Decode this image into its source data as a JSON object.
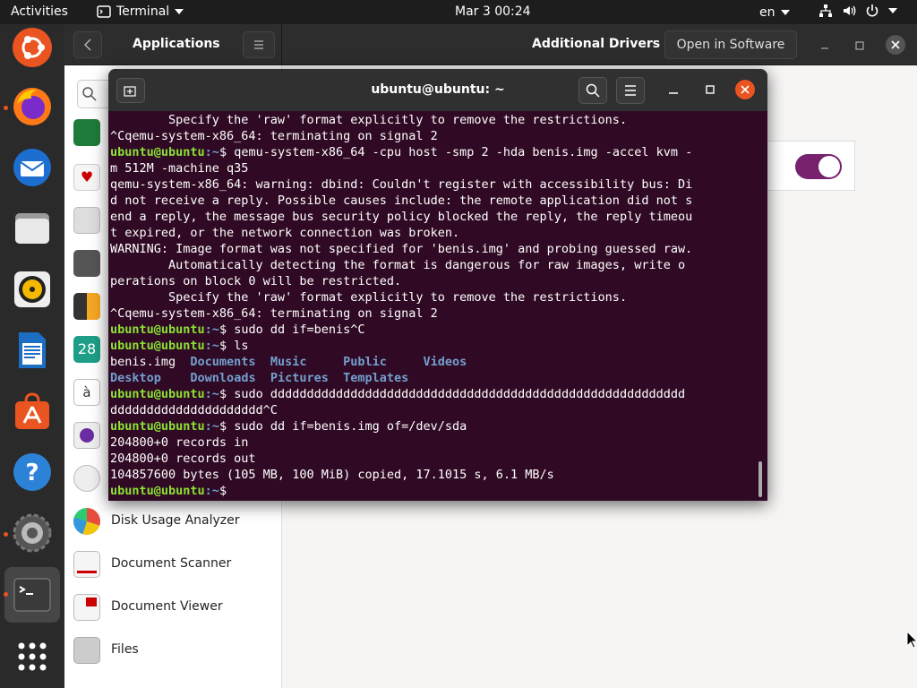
{
  "topbar": {
    "activities": "Activities",
    "app": "Terminal",
    "clock": "Mar 3  00:24",
    "lang": "en"
  },
  "dock": {
    "items": [
      "ubuntu-logo",
      "firefox",
      "thunderbird",
      "files",
      "rhythmbox",
      "libreoffice-writer",
      "ubuntu-software",
      "help",
      "settings",
      "terminal",
      "show-apps"
    ]
  },
  "software": {
    "header": {
      "section": "Applications",
      "title": "Additional Drivers",
      "open_button": "Open in Software"
    },
    "side_list": [
      "Disk Usage Analyzer",
      "Document Scanner",
      "Document Viewer",
      "Files"
    ],
    "side_icon_labels": {
      "calendar": "28",
      "charmap": "à"
    },
    "toggle_on": true
  },
  "terminal": {
    "title": "ubuntu@ubuntu: ~",
    "lines": [
      {
        "t": "        Specify the 'raw' format explicitly to remove the restrictions."
      },
      {
        "t": "^Cqemu-system-x86_64: terminating on signal 2"
      },
      {
        "user": "ubuntu@ubuntu",
        "path": ":~",
        "t": "$ qemu-system-x86_64 -cpu host -smp 2 -hda benis.img -accel kvm -"
      },
      {
        "t": "m 512M -machine q35"
      },
      {
        "t": "qemu-system-x86_64: warning: dbind: Couldn't register with accessibility bus: Di"
      },
      {
        "t": "d not receive a reply. Possible causes include: the remote application did not s"
      },
      {
        "t": "end a reply, the message bus security policy blocked the reply, the reply timeou"
      },
      {
        "t": "t expired, or the network connection was broken."
      },
      {
        "t": "WARNING: Image format was not specified for 'benis.img' and probing guessed raw."
      },
      {
        "t": "        Automatically detecting the format is dangerous for raw images, write o"
      },
      {
        "t": "perations on block 0 will be restricted."
      },
      {
        "t": "        Specify the 'raw' format explicitly to remove the restrictions."
      },
      {
        "t": "^Cqemu-system-x86_64: terminating on signal 2"
      },
      {
        "user": "ubuntu@ubuntu",
        "path": ":~",
        "t": "$ sudo dd if=benis^C"
      },
      {
        "user": "ubuntu@ubuntu",
        "path": ":~",
        "t": "$ ls"
      },
      {
        "ls": [
          {
            "f": "benis.img  "
          },
          {
            "d": "Documents"
          },
          {
            "f": "  "
          },
          {
            "d": "Music"
          },
          {
            "f": "     "
          },
          {
            "d": "Public"
          },
          {
            "f": "     "
          },
          {
            "d": "Videos"
          }
        ]
      },
      {
        "ls": [
          {
            "d": "Desktop"
          },
          {
            "f": "    "
          },
          {
            "d": "Downloads"
          },
          {
            "f": "  "
          },
          {
            "d": "Pictures"
          },
          {
            "f": "  "
          },
          {
            "d": "Templates"
          }
        ]
      },
      {
        "user": "ubuntu@ubuntu",
        "path": ":~",
        "t": "$ sudo ddddddddddddddddddddddddddddddddddddddddddddddddddddddddd"
      },
      {
        "t": "ddddddddddddddddddddd^C"
      },
      {
        "user": "ubuntu@ubuntu",
        "path": ":~",
        "t": "$ sudo dd if=benis.img of=/dev/sda"
      },
      {
        "t": "204800+0 records in"
      },
      {
        "t": "204800+0 records out"
      },
      {
        "t": "104857600 bytes (105 MB, 100 MiB) copied, 17.1015 s, 6.1 MB/s"
      },
      {
        "user": "ubuntu@ubuntu",
        "path": ":~",
        "t": "$ "
      }
    ]
  }
}
